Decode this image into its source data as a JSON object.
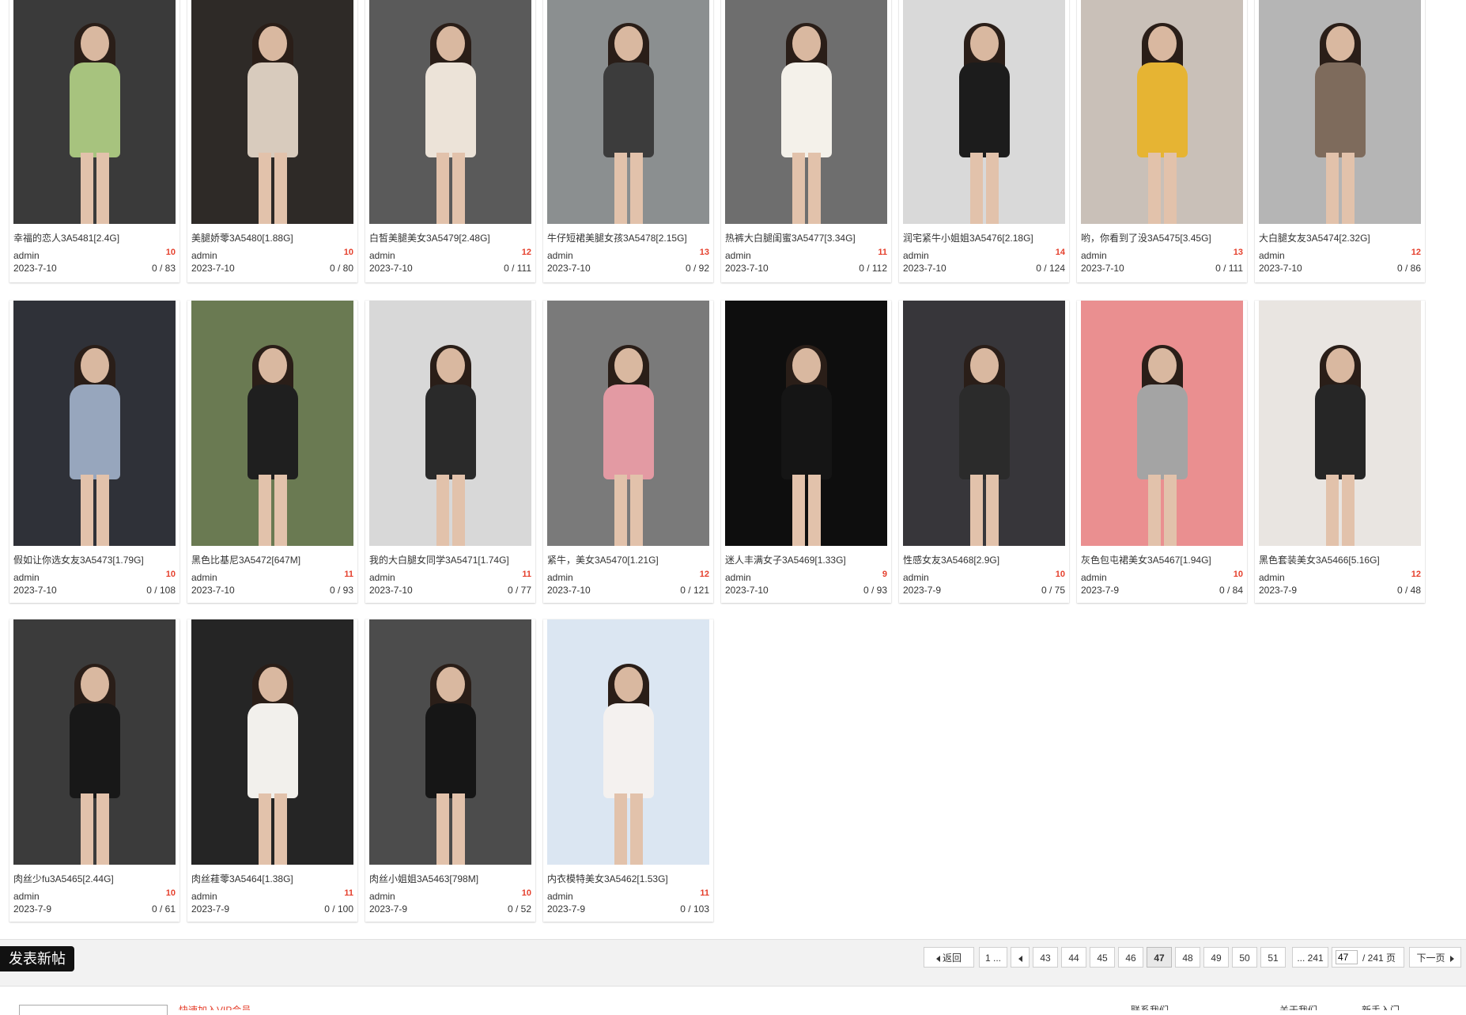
{
  "threads": [
    {
      "title": "幸福的恋人3A5481[2.4G]",
      "author": "admin",
      "replies": "10",
      "date": "2023-7-10",
      "views": "0 / 83",
      "color": "#a7c37e"
    },
    {
      "title": "美腿娇蕶3A5480[1.88G]",
      "author": "admin",
      "replies": "10",
      "date": "2023-7-10",
      "views": "0 / 80",
      "color": "#d8cbbd"
    },
    {
      "title": "白皙美腿美女3A5479[2.48G]",
      "author": "admin",
      "replies": "12",
      "date": "2023-7-10",
      "views": "0 / 111",
      "color": "#ece3d8"
    },
    {
      "title": "牛仔短裙美腿女孩3A5478[2.15G]",
      "author": "admin",
      "replies": "13",
      "date": "2023-7-10",
      "views": "0 / 92",
      "color": "#3c3c3c"
    },
    {
      "title": "热裤大白腿闺蜜3A5477[3.34G]",
      "author": "admin",
      "replies": "11",
      "date": "2023-7-10",
      "views": "0 / 112",
      "color": "#f4f1ea"
    },
    {
      "title": "润宅紧牛小姐姐3A5476[2.18G]",
      "author": "admin",
      "replies": "14",
      "date": "2023-7-10",
      "views": "0 / 124",
      "color": "#1c1c1c"
    },
    {
      "title": "哟，你看到了没3A5475[3.45G]",
      "author": "admin",
      "replies": "13",
      "date": "2023-7-10",
      "views": "0 / 111",
      "color": "#e6b433"
    },
    {
      "title": "大白腿女友3A5474[2.32G]",
      "author": "admin",
      "replies": "12",
      "date": "2023-7-10",
      "views": "0 / 86",
      "color": "#7e6b5c"
    },
    {
      "title": "假如让你选女友3A5473[1.79G]",
      "author": "admin",
      "replies": "10",
      "date": "2023-7-10",
      "views": "0 / 108",
      "color": "#97a6bd"
    },
    {
      "title": "黑色比基尼3A5472[647M]",
      "author": "admin",
      "replies": "11",
      "date": "2023-7-10",
      "views": "0 / 93",
      "color": "#1f1f1f"
    },
    {
      "title": "我的大白腿女同学3A5471[1.74G]",
      "author": "admin",
      "replies": "11",
      "date": "2023-7-10",
      "views": "0 / 77",
      "color": "#2a2a2a"
    },
    {
      "title": "紧牛，美女3A5470[1.21G]",
      "author": "admin",
      "replies": "12",
      "date": "2023-7-10",
      "views": "0 / 121",
      "color": "#e39aa3"
    },
    {
      "title": "迷人丰满女子3A5469[1.33G]",
      "author": "admin",
      "replies": "9",
      "date": "2023-7-10",
      "views": "0 / 93",
      "color": "#151515"
    },
    {
      "title": "性感女友3A5468[2.9G]",
      "author": "admin",
      "replies": "10",
      "date": "2023-7-9",
      "views": "0 / 75",
      "color": "#2b2b2b"
    },
    {
      "title": "灰色包屯裙美女3A5467[1.94G]",
      "author": "admin",
      "replies": "10",
      "date": "2023-7-9",
      "views": "0 / 84",
      "color": "#a4a4a4"
    },
    {
      "title": "黑色套装美女3A5466[5.16G]",
      "author": "admin",
      "replies": "12",
      "date": "2023-7-9",
      "views": "0 / 48",
      "color": "#262626"
    },
    {
      "title": "肉丝少fu3A5465[2.44G]",
      "author": "admin",
      "replies": "10",
      "date": "2023-7-9",
      "views": "0 / 61",
      "color": "#181818"
    },
    {
      "title": "肉丝蓕蕶3A5464[1.38G]",
      "author": "admin",
      "replies": "11",
      "date": "2023-7-9",
      "views": "0 / 100",
      "color": "#f2f0ec"
    },
    {
      "title": "肉丝小姐姐3A5463[798M]",
      "author": "admin",
      "replies": "10",
      "date": "2023-7-9",
      "views": "0 / 52",
      "color": "#161616"
    },
    {
      "title": "内衣模特美女3A5462[1.53G]",
      "author": "admin",
      "replies": "11",
      "date": "2023-7-9",
      "views": "0 / 103",
      "color": "#f4f1ef"
    }
  ],
  "thumb_bg": [
    "#3a3a3a",
    "#2e2a27",
    "#5a5a5a",
    "#8b8f90",
    "#6e6e6e",
    "#d9d9d9",
    "#c9c0b8",
    "#b5b5b5",
    "#2f3138",
    "#6a7a52",
    "#d8d8d8",
    "#7a7a7a",
    "#0e0e0e",
    "#37363a",
    "#ea8f90",
    "#e9e5e1",
    "#3b3b3b",
    "#252525",
    "#4c4c4c",
    "#dbe6f2"
  ],
  "new_post_label": "发表新帖",
  "pager": {
    "back": "返回",
    "first": "1 ...",
    "pages": [
      "43",
      "44",
      "45",
      "46",
      "47",
      "48",
      "49",
      "50",
      "51"
    ],
    "current": "47",
    "last": "... 241",
    "input_value": "47",
    "total": "/ 241 页",
    "next": "下一页"
  },
  "footer": {
    "promo": "快速加入VIP会员",
    "links": [
      "联系我们",
      "关于我们",
      "新手入门"
    ]
  },
  "colors": {
    "accent": "#e5402d",
    "dark_button": "#111111",
    "bar_bg": "#f2f2f2"
  }
}
